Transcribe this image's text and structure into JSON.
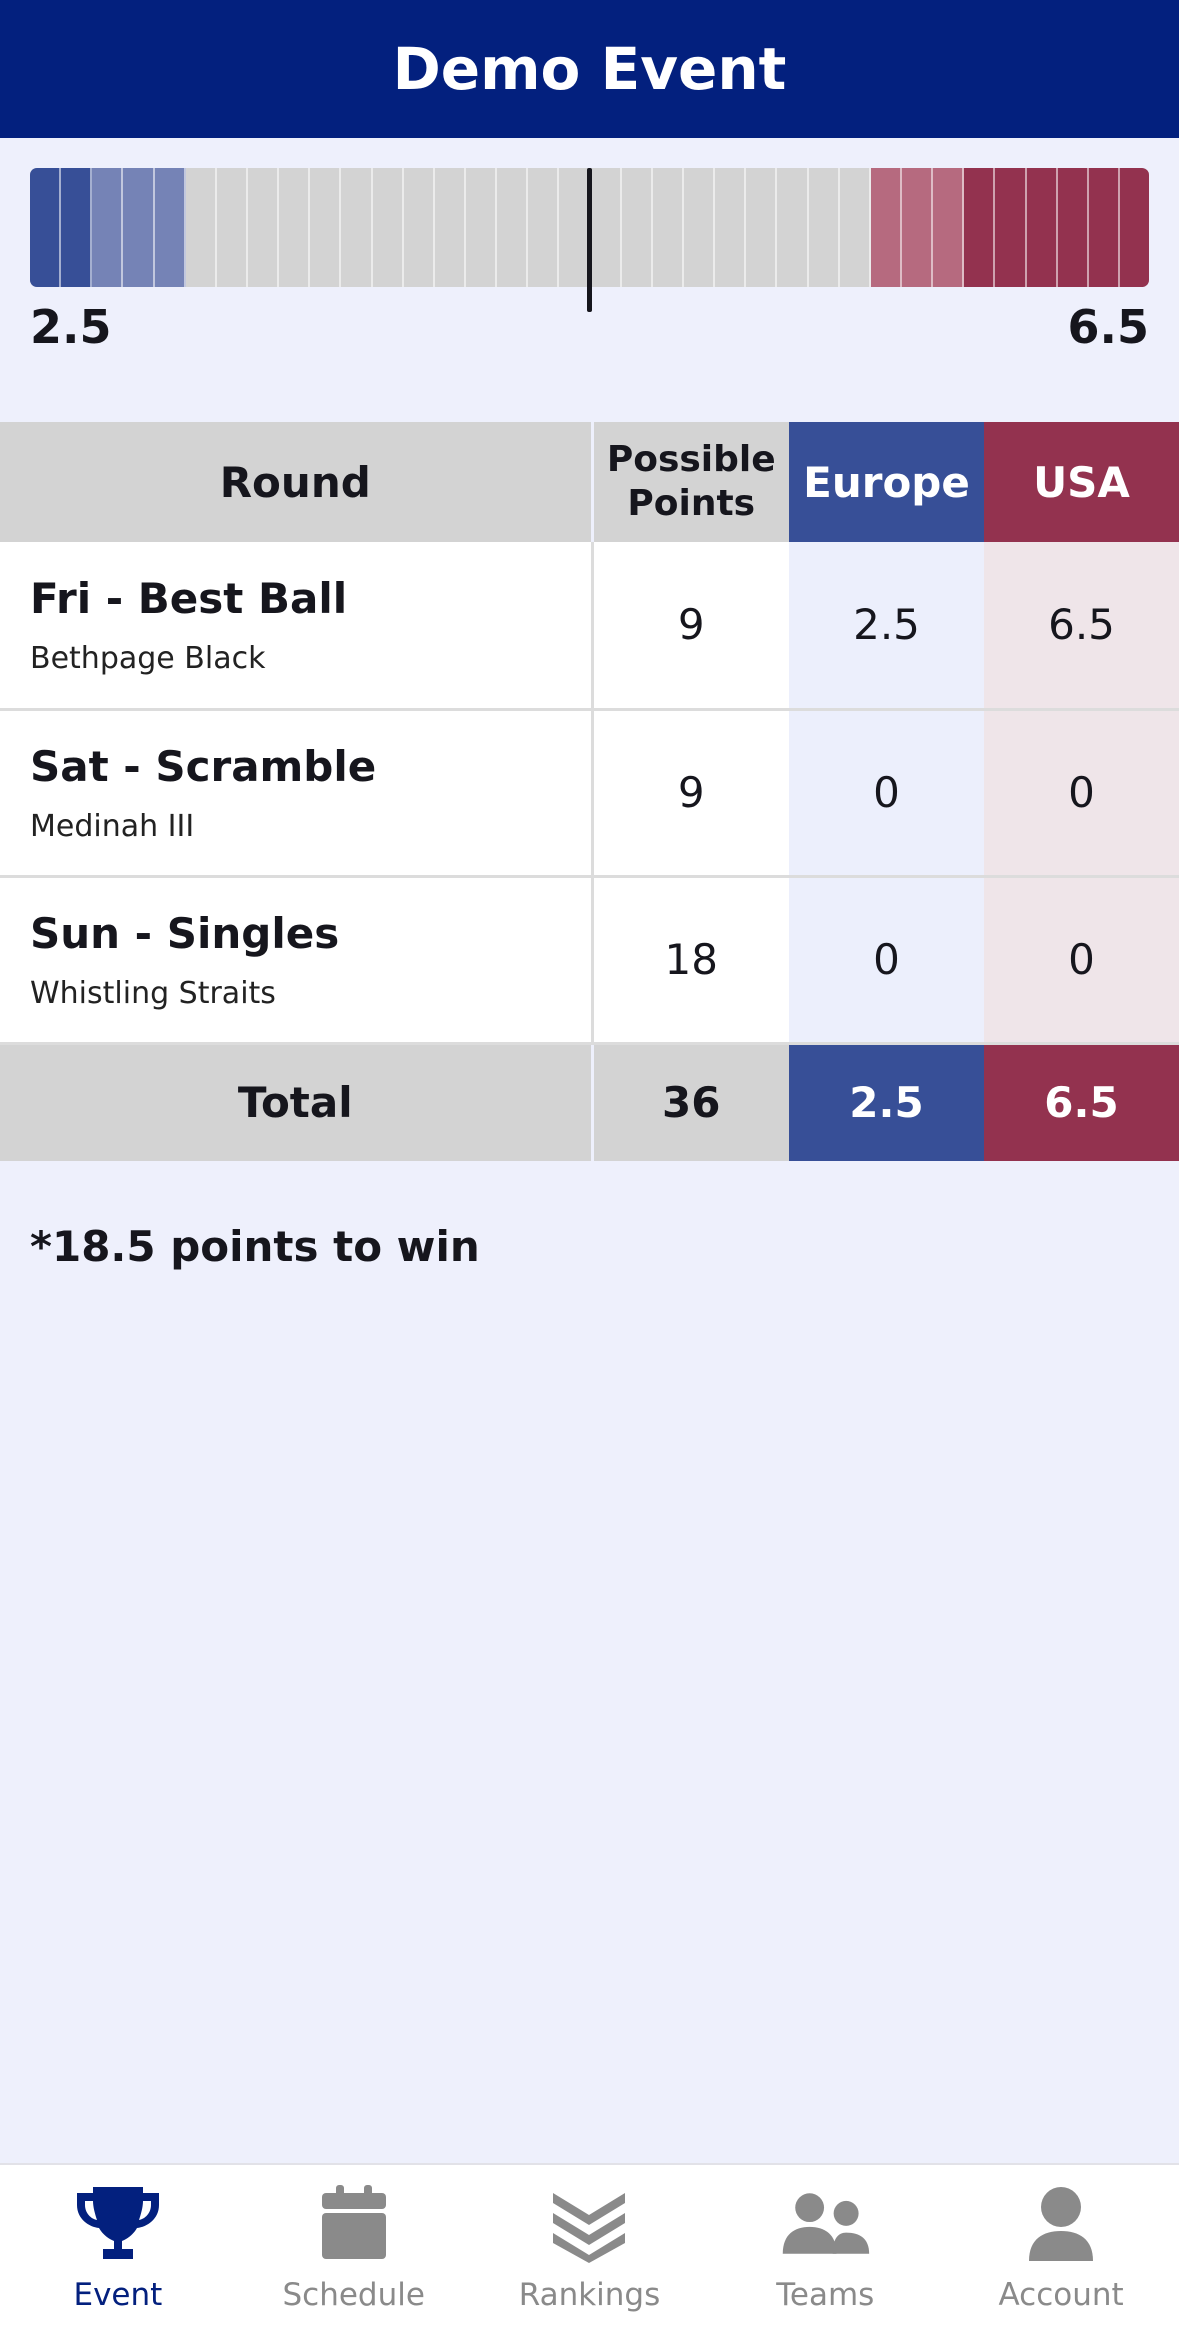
{
  "header": {
    "title": "Demo Event"
  },
  "score_bar": {
    "europe_score": "2.5",
    "usa_score": "6.5",
    "europe_color": "#374f97",
    "europe_light_color": "#7583b6",
    "usa_color": "#93324f",
    "usa_light_color": "#b66a7f",
    "neutral_color": "#d3d3d3"
  },
  "table": {
    "headers": {
      "round": "Round",
      "possible_line1": "Possible",
      "possible_line2": "Points",
      "europe": "Europe",
      "usa": "USA"
    },
    "rows": [
      {
        "round": "Fri - Best Ball",
        "course": "Bethpage Black",
        "possible": "9",
        "europe": "2.5",
        "usa": "6.5"
      },
      {
        "round": "Sat - Scramble",
        "course": "Medinah III",
        "possible": "9",
        "europe": "0",
        "usa": "0"
      },
      {
        "round": "Sun - Singles",
        "course": "Whistling Straits",
        "possible": "18",
        "europe": "0",
        "usa": "0"
      }
    ],
    "total": {
      "label": "Total",
      "possible": "36",
      "europe": "2.5",
      "usa": "6.5"
    }
  },
  "note": "*18.5 points to win",
  "nav": {
    "active_color": "#03207e",
    "inactive_color": "#8a8a8a",
    "items": [
      {
        "label": "Event",
        "icon": "trophy-icon"
      },
      {
        "label": "Schedule",
        "icon": "calendar-icon"
      },
      {
        "label": "Rankings",
        "icon": "chevrons-icon"
      },
      {
        "label": "Teams",
        "icon": "people-icon"
      },
      {
        "label": "Account",
        "icon": "person-icon"
      }
    ]
  }
}
